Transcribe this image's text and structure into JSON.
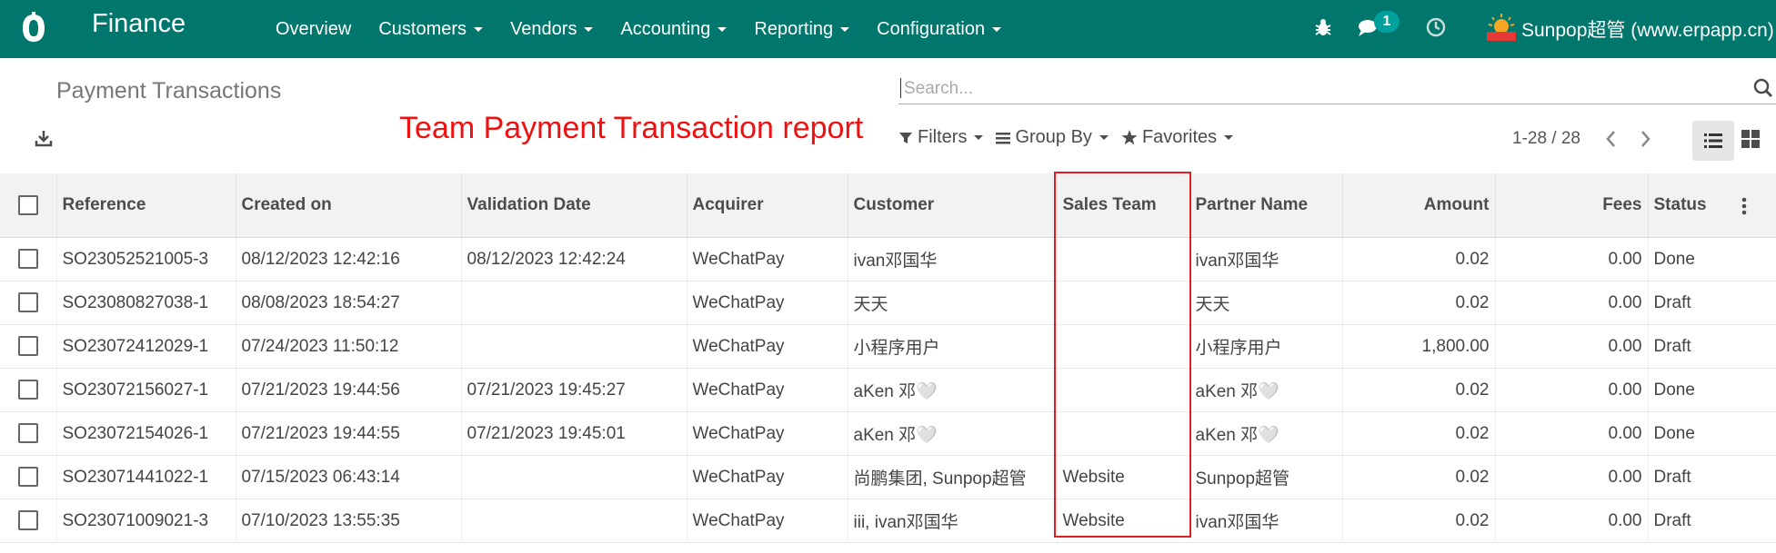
{
  "app": {
    "name": "Finance",
    "brand_color": "#00766c"
  },
  "menu": [
    {
      "label": "Overview",
      "has_dropdown": false
    },
    {
      "label": "Customers",
      "has_dropdown": true
    },
    {
      "label": "Vendors",
      "has_dropdown": true
    },
    {
      "label": "Accounting",
      "has_dropdown": true
    },
    {
      "label": "Reporting",
      "has_dropdown": true
    },
    {
      "label": "Configuration",
      "has_dropdown": true
    }
  ],
  "systray": {
    "messages_count": "1",
    "company": "Sunpop超管 (www.erpapp.cn)"
  },
  "breadcrumb": "Payment Transactions",
  "annotation": "Team Payment Transaction report",
  "search": {
    "placeholder": "Search..."
  },
  "filters": {
    "filters_label": "Filters",
    "group_by_label": "Group By",
    "favorites_label": "Favorites"
  },
  "pager": {
    "range": "1-28 / 28"
  },
  "table": {
    "columns": [
      "Reference",
      "Created on",
      "Validation Date",
      "Acquirer",
      "Customer",
      "Sales Team",
      "Partner Name",
      "Amount",
      "Fees",
      "Status"
    ],
    "rows": [
      [
        "SO23052521005-3",
        "08/12/2023 12:42:16",
        "08/12/2023 12:42:24",
        "WeChatPay",
        "ivan邓国华",
        "",
        "ivan邓国华",
        "0.02",
        "0.00",
        "Done"
      ],
      [
        "SO23080827038-1",
        "08/08/2023 18:54:27",
        "",
        "WeChatPay",
        "天天",
        "",
        "天天",
        "0.02",
        "0.00",
        "Draft"
      ],
      [
        "SO23072412029-1",
        "07/24/2023 11:50:12",
        "",
        "WeChatPay",
        "小程序用户",
        "",
        "小程序用户",
        "1,800.00",
        "0.00",
        "Draft"
      ],
      [
        "SO23072156027-1",
        "07/21/2023 19:44:56",
        "07/21/2023 19:45:27",
        "WeChatPay",
        "aKen 邓🤍",
        "",
        "aKen 邓🤍",
        "0.02",
        "0.00",
        "Done"
      ],
      [
        "SO23072154026-1",
        "07/21/2023 19:44:55",
        "07/21/2023 19:45:01",
        "WeChatPay",
        "aKen 邓🤍",
        "",
        "aKen 邓🤍",
        "0.02",
        "0.00",
        "Done"
      ],
      [
        "SO23071441022-1",
        "07/15/2023 06:43:14",
        "",
        "WeChatPay",
        "尚鹏集团, Sunpop超管",
        "Website",
        "Sunpop超管",
        "0.02",
        "0.00",
        "Draft"
      ],
      [
        "SO23071009021-3",
        "07/10/2023 13:55:35",
        "",
        "WeChatPay",
        "iii, ivan邓国华",
        "Website",
        "ivan邓国华",
        "0.02",
        "0.00",
        "Draft"
      ]
    ]
  }
}
